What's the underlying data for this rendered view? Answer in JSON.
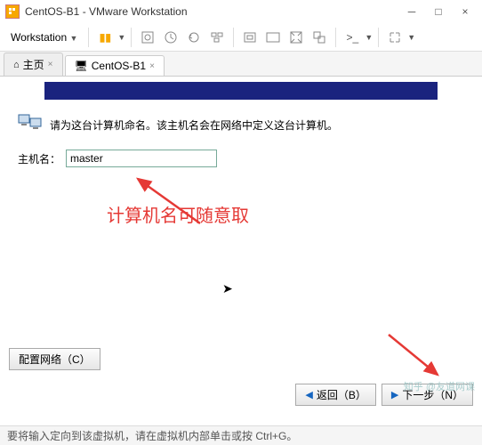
{
  "window": {
    "title": "CentOS-B1 - VMware Workstation"
  },
  "menu": {
    "workstation": "Workstation"
  },
  "tabs": {
    "home": "主页",
    "vm": "CentOS-B1"
  },
  "wizard": {
    "instruction": "请为这台计算机命名。该主机名会在网络中定义这台计算机。",
    "hostname_label": "主机名：",
    "hostname_value": "master"
  },
  "annotation": {
    "note": "计算机名可随意取"
  },
  "buttons": {
    "configure_network": "配置网络（C）",
    "back": "返回（B）",
    "next": "下一步（N）"
  },
  "statusbar": {
    "text": "要将输入定向到该虚拟机，请在虚拟机内部单击或按 Ctrl+G。"
  },
  "watermark": "知乎 @友道网课"
}
